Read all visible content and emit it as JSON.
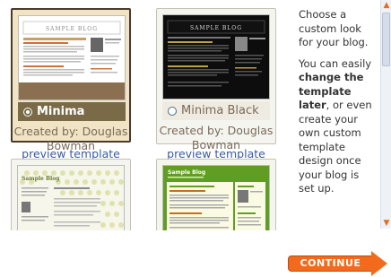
{
  "templates": [
    {
      "name": "Minima",
      "credit_label": "Created by: Douglas Bowman",
      "preview_link": "preview template",
      "selected": true,
      "thumb_title": "SAMPLE BLOG"
    },
    {
      "name": "Minima Black",
      "credit_label": "Created by: Douglas Bowman",
      "preview_link": "preview template",
      "selected": false,
      "thumb_title": "SAMPLE BLOG"
    },
    {
      "thumb_title": "Sample Blog"
    },
    {
      "thumb_title": "Sample Blog"
    }
  ],
  "sidebar_text": {
    "p1": "Choose a custom look for your blog.",
    "p2_a": "You can easily ",
    "p2_b": "change the template later",
    "p2_c": ", or even create your own custom template design once your blog is set up."
  },
  "continue_label": "CONTINUE",
  "colors": {
    "accent": "#f26b1d",
    "selected_bg": "#f0e4c4",
    "link": "#3a5aa0"
  }
}
